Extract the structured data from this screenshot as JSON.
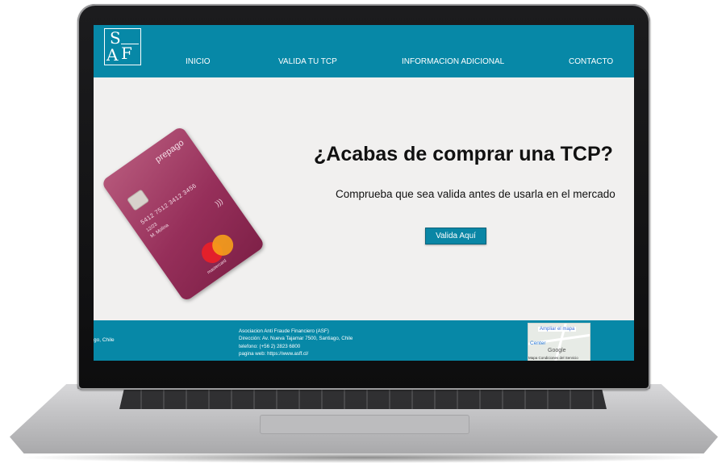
{
  "header": {
    "logo": {
      "s": "S",
      "a": "A",
      "f": "F"
    },
    "nav": [
      "INICIO",
      "VALIDA TU TCP",
      "INFORMACION ADICIONAL",
      "CONTACTO"
    ]
  },
  "hero": {
    "title": "¿Acabas de comprar una TCP?",
    "subtitle": "Comprueba que sea valida antes de usarla en el mercado",
    "button": "Valida Aquí"
  },
  "card": {
    "word": "prepago",
    "number": "5412 7512 3412 3456",
    "expiry": "12/23",
    "holder": "M. Molina",
    "brand": "mastercard"
  },
  "footer": {
    "left_text": "go, Chile",
    "lines": [
      "Asociacion Anti Fraude Financiero (ASF)",
      "Dirección: Av. Nueva Tajamar 7500, Santiago, Chile",
      "telefono: (+56 2) 2823 6800",
      "pagina web: https://www.asff.cl/"
    ],
    "map": {
      "enlarge": "Ampliar el mapa",
      "place": "Center",
      "google": "Google",
      "terms": "Mapa   Condiciones del Servicio"
    }
  },
  "colors": {
    "primary": "#0788a7",
    "background": "#f1f0ef",
    "card": "#962f5a"
  }
}
